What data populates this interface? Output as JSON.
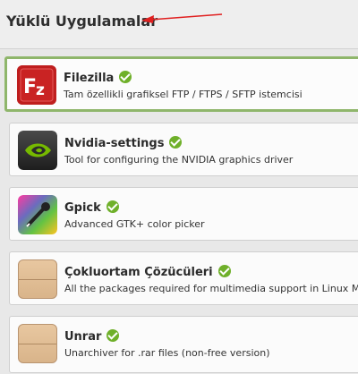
{
  "header": {
    "title": "Yüklü Uygulamalar"
  },
  "apps": [
    {
      "name": "Filezilla",
      "description": "Tam özellikli grafiksel FTP / FTPS / SFTP istemcisi",
      "icon": "filezilla-icon",
      "installed": true,
      "selected": true
    },
    {
      "name": "Nvidia-settings",
      "description": "Tool for configuring the NVIDIA graphics driver",
      "icon": "nvidia-icon",
      "installed": true
    },
    {
      "name": "Gpick",
      "description": "Advanced GTK+ color picker",
      "icon": "gpick-icon",
      "installed": true
    },
    {
      "name": "Çokluortam Çözücüleri",
      "description": "All the packages required for multimedia support in Linux Mint.",
      "icon": "package-icon",
      "installed": true
    },
    {
      "name": "Unrar",
      "description": "Unarchiver for .rar files (non-free version)",
      "icon": "package-icon",
      "installed": true
    }
  ],
  "colors": {
    "selected_border": "#8fb66b",
    "installed_check": "#6fb02a",
    "annotation_arrow": "#e02020"
  }
}
